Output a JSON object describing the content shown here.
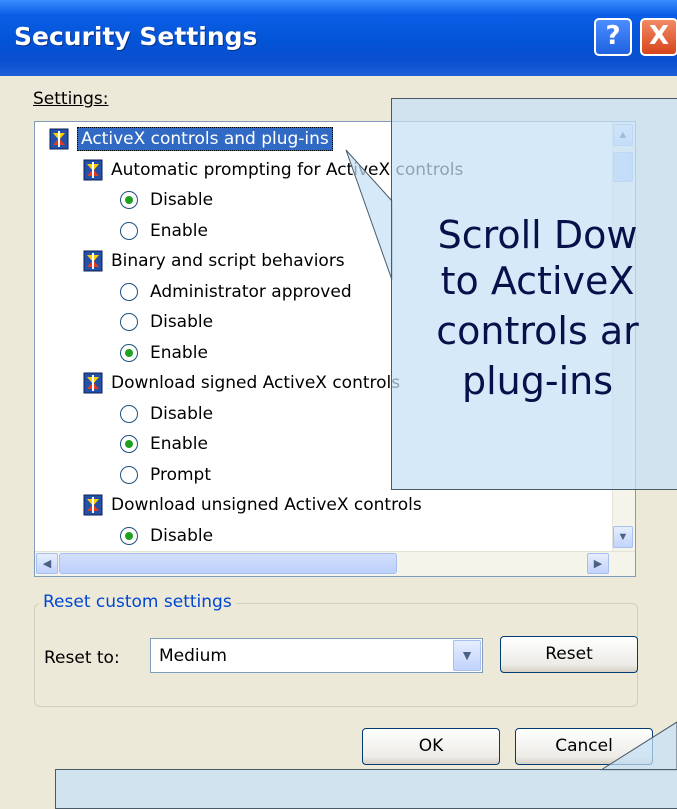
{
  "window": {
    "title": "Security Settings",
    "help_button": "?",
    "close_button": "X"
  },
  "settings_label": "Settings:",
  "tree": [
    {
      "kind": "category",
      "label": "ActiveX controls and plug-ins",
      "selected": true
    },
    {
      "kind": "setting",
      "label": "Automatic prompting for ActiveX controls"
    },
    {
      "kind": "option",
      "label": "Disable",
      "checked": true
    },
    {
      "kind": "option",
      "label": "Enable",
      "checked": false
    },
    {
      "kind": "setting",
      "label": "Binary and script behaviors"
    },
    {
      "kind": "option",
      "label": "Administrator approved",
      "checked": false
    },
    {
      "kind": "option",
      "label": "Disable",
      "checked": false
    },
    {
      "kind": "option",
      "label": "Enable",
      "checked": true
    },
    {
      "kind": "setting",
      "label": "Download signed ActiveX controls"
    },
    {
      "kind": "option",
      "label": "Disable",
      "checked": false
    },
    {
      "kind": "option",
      "label": "Enable",
      "checked": true
    },
    {
      "kind": "option",
      "label": "Prompt",
      "checked": false
    },
    {
      "kind": "setting",
      "label": "Download unsigned ActiveX controls"
    },
    {
      "kind": "option",
      "label": "Disable",
      "checked": true
    }
  ],
  "reset_group": {
    "legend": "Reset custom settings",
    "reset_to_label": "Reset to:",
    "reset_to_value": "Medium",
    "reset_button": "Reset"
  },
  "ok_button": "OK",
  "cancel_button": "Cancel",
  "callout": {
    "lines": [
      "Scroll Dow",
      "to ActiveX",
      "controls ar",
      "plug-ins"
    ]
  },
  "icons": {
    "help": "help-icon",
    "close": "close-icon",
    "category": "settings-category-icon",
    "scroll_up": "scroll-up-icon",
    "scroll_down": "scroll-down-icon",
    "scroll_left": "scroll-left-icon",
    "scroll_right": "scroll-right-icon",
    "dropdown": "dropdown-arrow-icon"
  },
  "colors": {
    "titlebar": "#0353d6",
    "selection": "#316ac5",
    "callout_fill": "#c5e1f7",
    "group_legend": "#0046d5"
  }
}
